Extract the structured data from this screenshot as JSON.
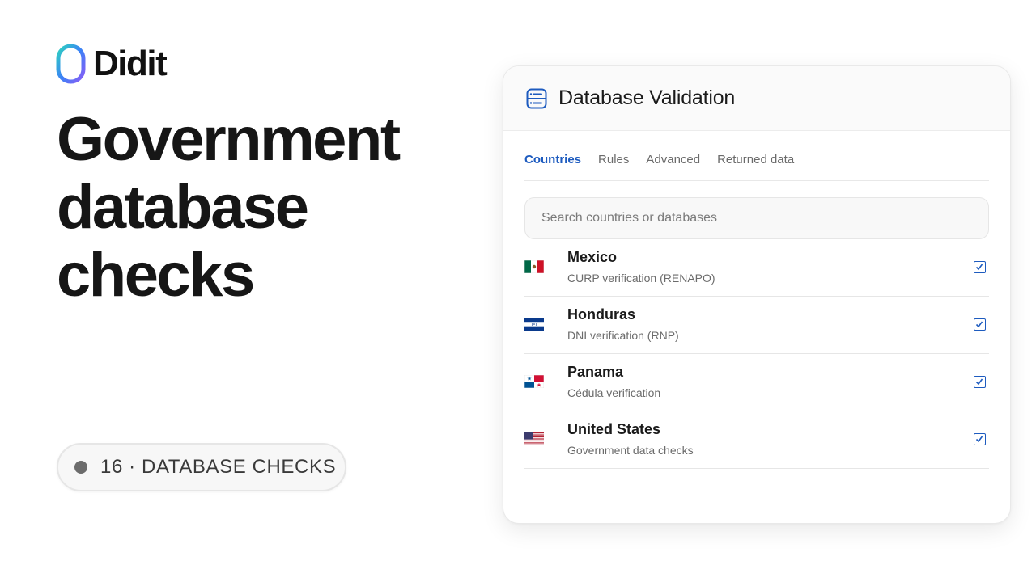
{
  "brand": {
    "name": "Didit",
    "logo_gradient": [
      "#3b82f6",
      "#8b5cf6",
      "#2dd4bf"
    ]
  },
  "hero": {
    "line1": "Government",
    "line2": "database",
    "line3": "checks"
  },
  "badge": {
    "text": "16 · DATABASE CHECKS",
    "dot_color": "#6c6c6c"
  },
  "card": {
    "icon": "database-icon",
    "title": "Database Validation",
    "tabs": [
      {
        "label": "Countries",
        "active": true
      },
      {
        "label": "Rules",
        "active": false
      },
      {
        "label": "Advanced",
        "active": false
      },
      {
        "label": "Returned data",
        "active": false
      }
    ],
    "search": {
      "placeholder": "Search countries or databases",
      "value": ""
    },
    "rows": [
      {
        "country": "Mexico",
        "detail": "CURP verification (RENAPO)",
        "flag": "mexico-flag-icon",
        "checked": true
      },
      {
        "country": "Honduras",
        "detail": "DNI verification (RNP)",
        "flag": "honduras-flag-icon",
        "checked": true
      },
      {
        "country": "Panama",
        "detail": "Cédula verification",
        "flag": "panama-flag-icon",
        "checked": true
      },
      {
        "country": "United States",
        "detail": "Government data checks",
        "flag": "usa-flag-icon",
        "checked": true
      }
    ],
    "accent_color": "#1d5bbf"
  }
}
